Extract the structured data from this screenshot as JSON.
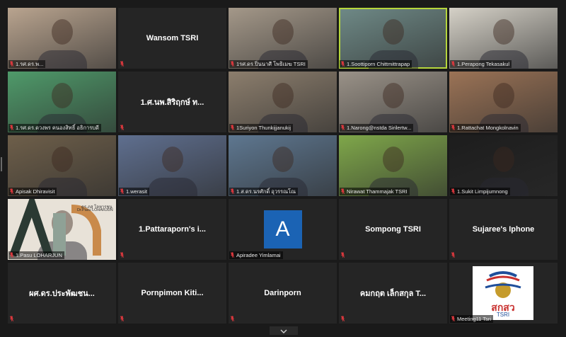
{
  "participants": [
    {
      "name": "1.รศ.ดร.พ...",
      "center": "",
      "bg": "#b9a48f",
      "video": true
    },
    {
      "name": "",
      "center": "Wansom TSRI",
      "bg": "",
      "video": false
    },
    {
      "name": "1รศ.ดร.ปิ่นนาศี โพธิเมฆ  TSRI",
      "center": "",
      "bg": "#a49889",
      "video": true
    },
    {
      "name": "1.Soottiporn Chittmittrapap",
      "center": "",
      "bg": "#6f8a87",
      "video": true,
      "active": true
    },
    {
      "name": "1.Perapong Tekasakul",
      "center": "",
      "bg": "#d5d1c7",
      "video": true
    },
    {
      "name": "1.รศ.ดร.ดวงพร คนองสิทธิ์ อธิการบดี",
      "center": "",
      "bg": "#4f9a6a",
      "video": true
    },
    {
      "name": "",
      "center": "1.ศ.นพ.สิริฤกษ์ ท...",
      "bg": "",
      "video": false
    },
    {
      "name": "1Suriyon Thunkijjanukij",
      "center": "",
      "bg": "#8c7e6d",
      "video": true
    },
    {
      "name": "1.Narong@nstda Sirilertw...",
      "center": "",
      "bg": "#9a9288",
      "video": true
    },
    {
      "name": "1.Rattachat Mongkolnavin",
      "center": "",
      "bg": "#9b7356",
      "video": true
    },
    {
      "name": "Apisak Dhiravisit",
      "center": "",
      "bg": "#6e5f4a",
      "video": true
    },
    {
      "name": "1.werasit",
      "center": "",
      "bg": "#5f6f8f",
      "video": true
    },
    {
      "name": "1.ส.ดร.นรศักดิ์ อุวรรณโณ",
      "center": "",
      "bg": "#5e7790",
      "video": true
    },
    {
      "name": "Nirawat Thammajak TSRI",
      "center": "",
      "bg": "#7fa74a",
      "video": true
    },
    {
      "name": "1.Sukit Limpijumnong",
      "center": "",
      "bg": "#1d1d1d",
      "video": true
    },
    {
      "name": "1.Pasu LOHARJUN",
      "center": "",
      "bg": "#e8e2d8",
      "video": true
    },
    {
      "name": "",
      "center": "1.Pattaraporn's i...",
      "bg": "",
      "video": false
    },
    {
      "name": "Apiradee Yimlamai",
      "center": "",
      "bg": "",
      "video": false,
      "avatar": "A"
    },
    {
      "name": "",
      "center": "Sompong TSRI",
      "bg": "",
      "video": false
    },
    {
      "name": "",
      "center": "Sujaree's Iphone",
      "bg": "",
      "video": false
    },
    {
      "name": "",
      "center": "ผศ.ดร.ประพัฒชน...",
      "bg": "",
      "video": false
    },
    {
      "name": "",
      "center": "Pornpimon  Kiti...",
      "bg": "",
      "video": false
    },
    {
      "name": "",
      "center": "Darinporn",
      "bg": "",
      "video": false
    },
    {
      "name": "",
      "center": "คมกฤต เล็กสกุล T...",
      "bg": "",
      "video": false
    },
    {
      "name": "Meeting11 Tsri",
      "center": "",
      "bg": "",
      "video": false,
      "logo": true
    }
  ],
  "tile_texts": {
    "pasu_logo_line1": "ดร.ภสุ โลหารชุน",
    "pasu_logo_line2": "Dr.Pasu LOHARJUN",
    "tsri_logo_thai": "สกสว",
    "tsri_logo_en": "TSRI"
  },
  "icons": {
    "muted_mic": "mic-off-icon",
    "page_down": "chevron-down-icon"
  },
  "colors": {
    "background": "#1a1a1a",
    "tile": "#252525",
    "active_speaker": "#b6d63c",
    "muted": "#e0393e",
    "avatar": "#1b63b4"
  }
}
